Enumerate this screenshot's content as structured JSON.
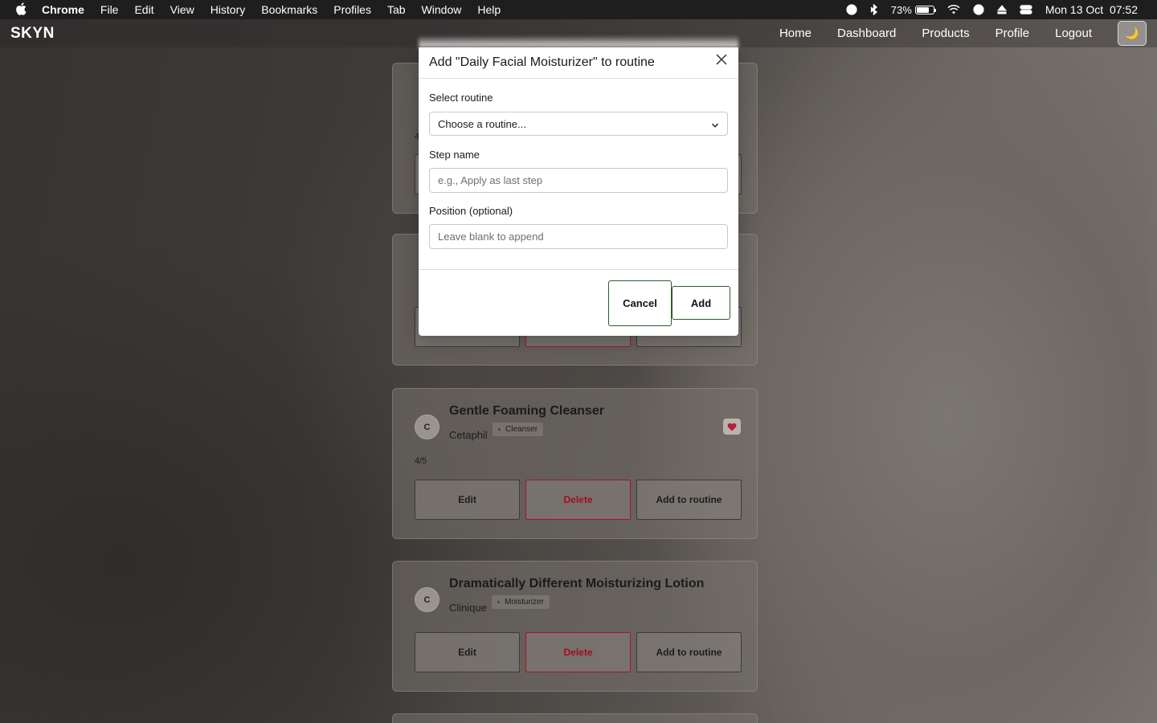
{
  "mac_menubar": {
    "app_name": "Chrome",
    "menus": [
      "File",
      "Edit",
      "View",
      "History",
      "Bookmarks",
      "Profiles",
      "Tab",
      "Window",
      "Help"
    ],
    "battery_percent": "73%",
    "battery_level": 0.73,
    "datetime": "Mon 13 Oct  07:52"
  },
  "navbar": {
    "brand": "SKYN",
    "links": [
      "Home",
      "Dashboard",
      "Products",
      "Profile",
      "Logout"
    ],
    "theme_icon": "moon-icon",
    "theme_glyph": "🌙"
  },
  "cards": [
    {
      "avatar": "",
      "title": "",
      "brand": "",
      "tag": "",
      "rating": "4",
      "buttons": []
    },
    {
      "avatar": "",
      "title": "",
      "brand": "",
      "tag": "",
      "rating": "",
      "buttons": [
        "",
        "",
        ""
      ]
    },
    {
      "avatar": "C",
      "title": "Gentle Foaming Cleanser",
      "brand": "Cetaphil",
      "tag": "Cleanser",
      "rating": "4/5",
      "favorite": true,
      "buttons": [
        "Edit",
        "Delete",
        "Add to routine"
      ]
    },
    {
      "avatar": "C",
      "title": "Dramatically Different Moisturizing Lotion",
      "brand": "Clinique",
      "tag": "Moisturizer",
      "rating": "",
      "buttons": [
        "Edit",
        "Delete",
        "Add to routine"
      ]
    }
  ],
  "modal": {
    "title": "Add \"Daily Facial Moisturizer\" to routine",
    "close_icon": "close-icon",
    "routine_label": "Select routine",
    "routine_value": "Choose a routine...",
    "step_label": "Step name",
    "step_placeholder": "e.g., Apply as last step",
    "position_label": "Position (optional)",
    "position_placeholder": "Leave blank to append",
    "cancel_label": "Cancel",
    "add_label": "Add"
  },
  "colors": {
    "accent_green": "#2e5a2e",
    "danger": "#b01028",
    "heart": "#b3203a"
  }
}
